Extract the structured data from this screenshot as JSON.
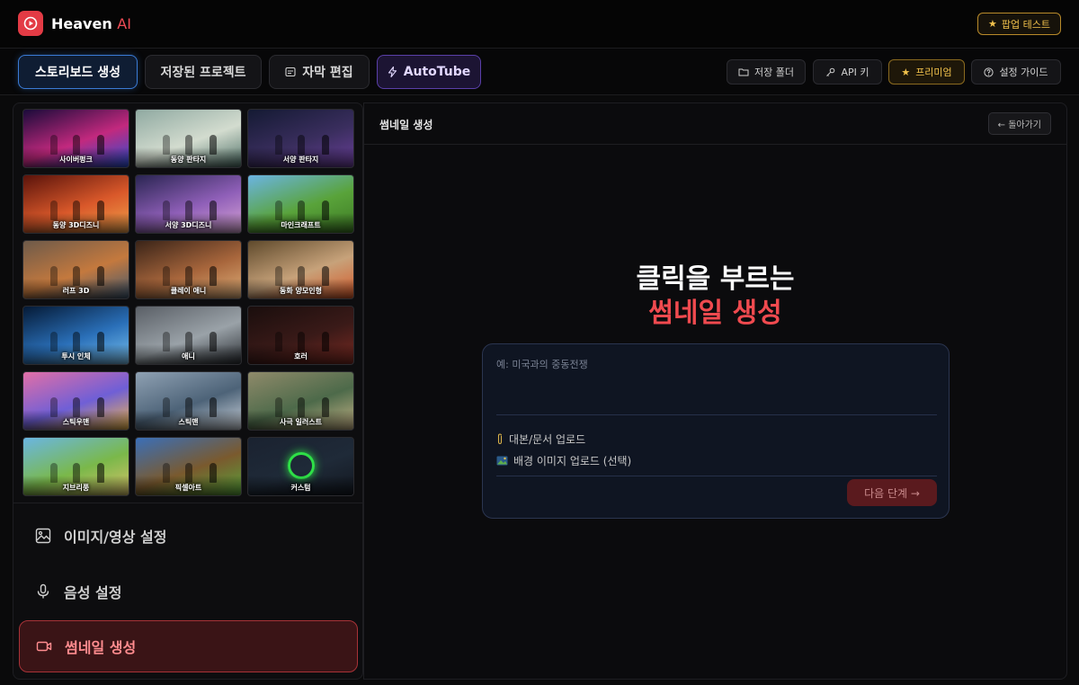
{
  "app": {
    "name": "Heaven",
    "name_suffix": "AI",
    "popup_test": "팝업 테스트"
  },
  "nav": {
    "tabs": [
      {
        "label": "스토리보드 생성"
      },
      {
        "label": "저장된 프로젝트"
      },
      {
        "label": "자막 편집"
      },
      {
        "label": "AutoTube"
      }
    ],
    "actions": [
      {
        "label": "저장 폴더"
      },
      {
        "label": "API 키"
      },
      {
        "label": "프리미엄"
      },
      {
        "label": "설정 가이드"
      }
    ]
  },
  "styles": [
    {
      "label": "사이버펑크",
      "colors": [
        "#1a0b3a",
        "#c2297e",
        "#2b4fd6"
      ]
    },
    {
      "label": "동양 판타지",
      "colors": [
        "#8fa9a1",
        "#d3dccf",
        "#4d6f66"
      ]
    },
    {
      "label": "서양 판타지",
      "colors": [
        "#141a33",
        "#3a2e5e",
        "#6a3f9a"
      ]
    },
    {
      "label": "동양 3D디즈니",
      "colors": [
        "#5a130b",
        "#d9582a",
        "#f2a34b"
      ]
    },
    {
      "label": "서양 3D디즈니",
      "colors": [
        "#2a2552",
        "#8f5fb8",
        "#d9a5d6"
      ]
    },
    {
      "label": "마인크래프트",
      "colors": [
        "#6bb4e3",
        "#59a33a",
        "#3d7a24"
      ]
    },
    {
      "label": "러프 3D",
      "colors": [
        "#6d5a4a",
        "#c4793e",
        "#3f5870"
      ]
    },
    {
      "label": "클레이 애니",
      "colors": [
        "#3a2418",
        "#a8663c",
        "#e0b07a"
      ]
    },
    {
      "label": "동화 양모인형",
      "colors": [
        "#5f4a2c",
        "#c7a27a",
        "#d65a2a"
      ]
    },
    {
      "label": "투시 인체",
      "colors": [
        "#051a36",
        "#2a6fb8",
        "#7ac3f0"
      ]
    },
    {
      "label": "애니",
      "colors": [
        "#5a5f66",
        "#9aa2a8",
        "#2a2e33"
      ]
    },
    {
      "label": "호러",
      "colors": [
        "#1a0e0d",
        "#3a1a18",
        "#7a2a22"
      ]
    },
    {
      "label": "스틱우맨",
      "colors": [
        "#e26fa6",
        "#6f5fd6",
        "#f2b94b"
      ]
    },
    {
      "label": "스틱맨",
      "colors": [
        "#8fa1b3",
        "#4d6378",
        "#cfd6de"
      ]
    },
    {
      "label": "사극 일러스트",
      "colors": [
        "#8f8a6a",
        "#4d6a4a",
        "#c7b487"
      ]
    },
    {
      "label": "지브리풍",
      "colors": [
        "#6ab6e3",
        "#7ab84a",
        "#d9c36a"
      ]
    },
    {
      "label": "픽셀아트",
      "colors": [
        "#3a6fb8",
        "#7a5a2e",
        "#59a33a"
      ]
    },
    {
      "label": "커스텀",
      "colors": [
        "#1a2230",
        "#1f2a38",
        "#12171f"
      ]
    }
  ],
  "menu": [
    {
      "label": "이미지/영상 설정"
    },
    {
      "label": "음성 설정"
    },
    {
      "label": "썸네일 생성"
    }
  ],
  "panel": {
    "title": "썸네일 생성",
    "back": "← 돌아가기",
    "hero_line1": "클릭을 부르는",
    "hero_line2": "썸네일 생성",
    "topic_placeholder": "예: 미국과의 중동전쟁",
    "upload_script": "대본/문서 업로드",
    "upload_bg": "배경 이미지 업로드 (선택)",
    "next": "다음 단계 →"
  }
}
